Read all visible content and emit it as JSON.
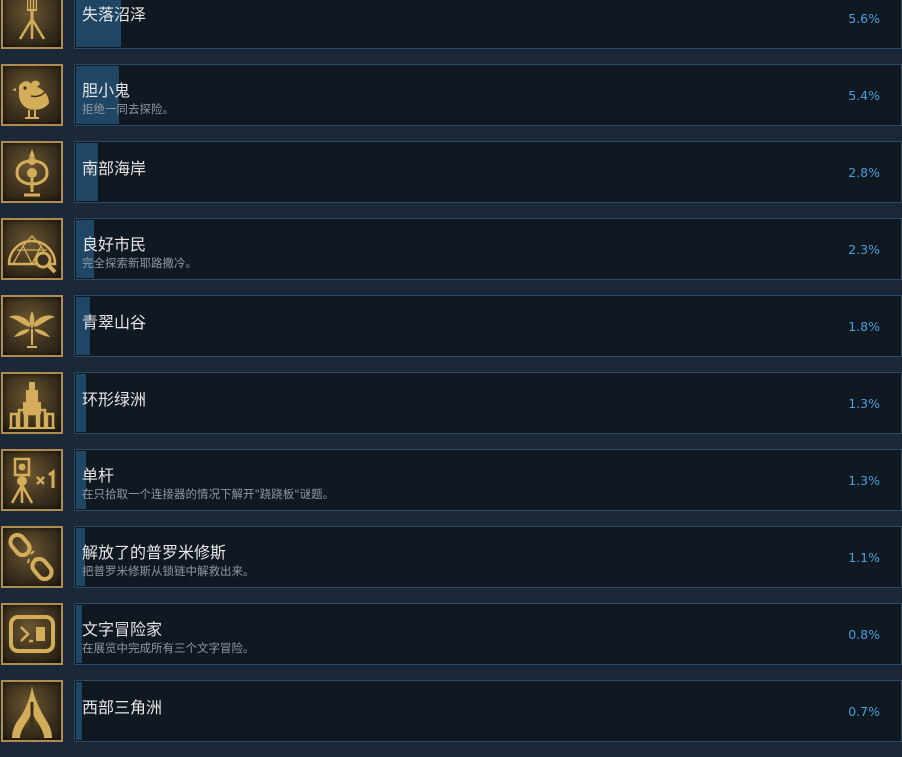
{
  "achievements": [
    {
      "name": "失落沼泽",
      "description": "",
      "percent": "5.6%",
      "progress": 5.6,
      "icon": "surveyor-lamp-icon"
    },
    {
      "name": "胆小鬼",
      "description": "拒绝一同去探险。",
      "percent": "5.4%",
      "progress": 5.4,
      "icon": "chicken-icon"
    },
    {
      "name": "南部海岸",
      "description": "",
      "percent": "2.8%",
      "progress": 2.8,
      "icon": "coastal-emblem-icon"
    },
    {
      "name": "良好市民",
      "description": "完全探索新耶路撒冷。",
      "percent": "2.3%",
      "progress": 2.3,
      "icon": "dome-magnifier-icon"
    },
    {
      "name": "青翠山谷",
      "description": "",
      "percent": "1.8%",
      "progress": 1.8,
      "icon": "winged-plant-icon"
    },
    {
      "name": "环形绿洲",
      "description": "",
      "percent": "1.3%",
      "progress": 1.3,
      "icon": "tower-icon"
    },
    {
      "name": "单杆",
      "description": "在只拾取一个连接器的情况下解开\"跷跷板\"谜题。",
      "percent": "1.3%",
      "progress": 1.3,
      "icon": "connector-x1-icon"
    },
    {
      "name": "解放了的普罗米修斯",
      "description": "把普罗米修斯从锁链中解救出来。",
      "percent": "1.1%",
      "progress": 1.1,
      "icon": "broken-chain-icon"
    },
    {
      "name": "文字冒险家",
      "description": "在展览中完成所有三个文字冒险。",
      "percent": "0.8%",
      "progress": 0.8,
      "icon": "terminal-icon"
    },
    {
      "name": "西部三角洲",
      "description": "",
      "percent": "0.7%",
      "progress": 0.7,
      "icon": "delta-icon"
    }
  ],
  "colors": {
    "background": "#1b2838",
    "progress_fill": "#1f4664",
    "percent_text": "#4a9fd8",
    "icon_gold": "#c9a24e"
  }
}
